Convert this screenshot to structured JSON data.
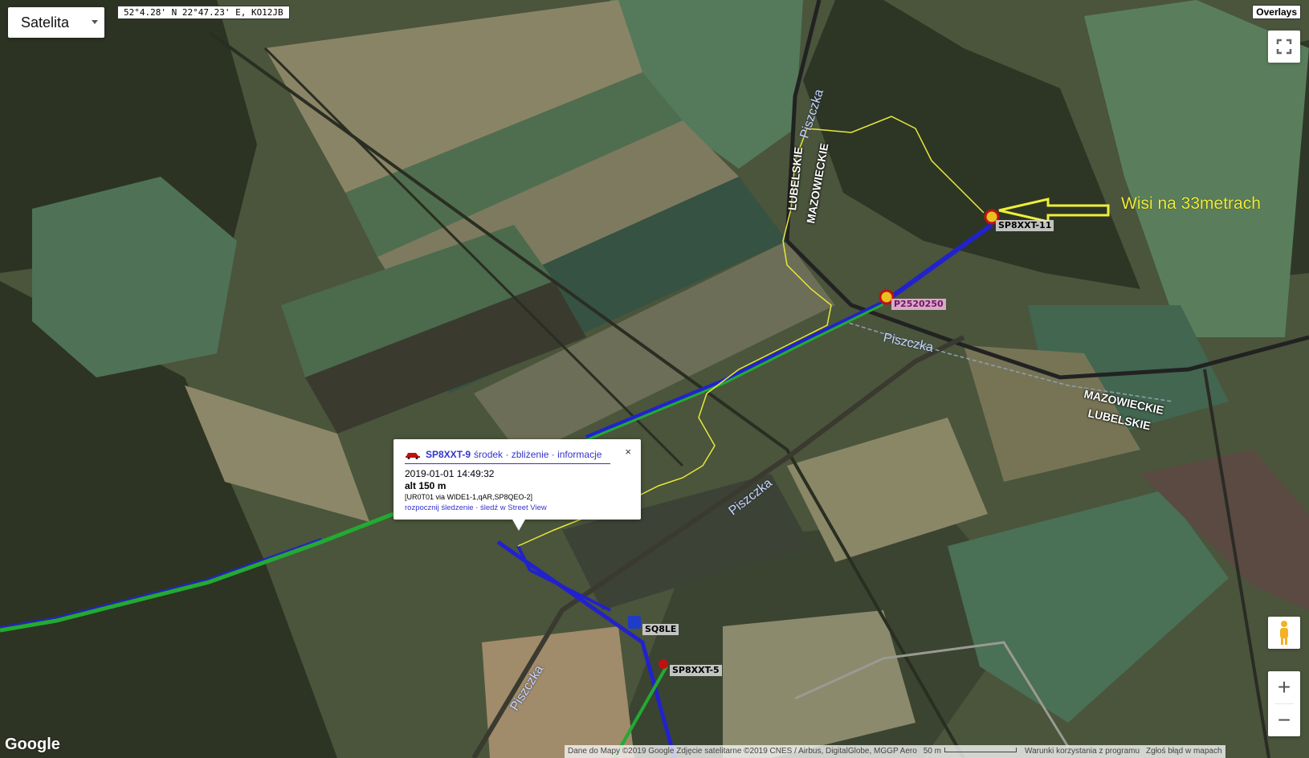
{
  "map_type_control": {
    "label": "Satelita"
  },
  "coordinates_readout": "52°4.28' N 22°47.23' E, KO12JB",
  "overlays_button": "Overlays",
  "stations": [
    {
      "callsign": "SP8XXT-11",
      "style": "grey"
    },
    {
      "callsign": "P2520250",
      "style": "pink"
    },
    {
      "callsign": "SQ8LE",
      "style": "grey"
    },
    {
      "callsign": "SP8XXT-5",
      "style": "grey"
    }
  ],
  "annotation": {
    "text": "Wisi na 33metrach",
    "color": "#f0ee3a"
  },
  "road_labels": [
    "LUBELSKIE",
    "MAZOWIECKIE",
    "MAZOWIECKIE",
    "LUBELSKIE"
  ],
  "river_labels": [
    "Piszczka",
    "Piszczka",
    "Piszczka",
    "Piszczka"
  ],
  "info_window": {
    "callsign": "SP8XXT-9",
    "links": "środek · zbliżenie · informacje",
    "close": "×",
    "timestamp": "2019-01-01 14:49:32",
    "altitude": "alt 150 m",
    "path": "[UR0T01 via WIDE1-1,qAR,SP8QEO-2]",
    "track_links": "rozpocznij śledzenie · śledź w Street View"
  },
  "zoom": {
    "in": "+",
    "out": "−"
  },
  "google_logo": "Google",
  "attribution": {
    "data": "Dane do Mapy ©2019 Google Zdjęcie satelitarne ©2019 CNES / Airbus, DigitalGlobe, MGGP Aero",
    "scale": "50 m",
    "terms": "Warunki korzystania z programu",
    "report": "Zgłoś błąd w mapach"
  },
  "colors": {
    "track_blue": "#2222cc",
    "track_green": "#22aa33",
    "gps_track_yellow": "#e8e83a"
  }
}
